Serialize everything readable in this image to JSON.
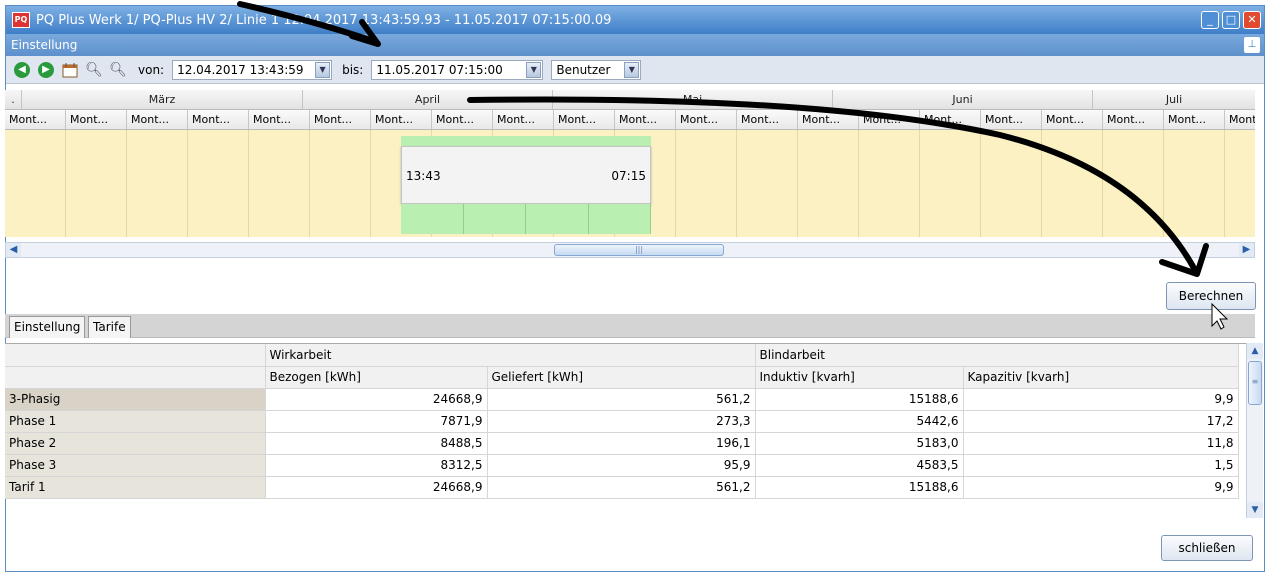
{
  "window": {
    "title": "PQ Plus Werk 1/ PQ-Plus HV 2/ Linie 1 12.04.2017 13:43:59.93 - 11.05.2017 07:15:00.09",
    "icon": "app-logo-icon"
  },
  "panel": {
    "title": "Einstellung",
    "pin_icon": "pin-icon"
  },
  "toolbar": {
    "von_label": "von:",
    "von_value": "12.04.2017 13:43:59",
    "bis_label": "bis:",
    "bis_value": "11.05.2017 07:15:00",
    "mode_value": "Benutzer"
  },
  "timeline": {
    "corner": ".",
    "months": [
      "März",
      "April",
      "Mai",
      "Juni",
      "Juli"
    ],
    "week_label": "Mont...",
    "selection_start": "13:43",
    "selection_end": "07:15"
  },
  "actions": {
    "berechnen": "Berechnen",
    "schliessen": "schließen"
  },
  "tabs": [
    "Einstellung",
    "Tarife"
  ],
  "table": {
    "group_headers": [
      "Wirkarbeit",
      "Blindarbeit"
    ],
    "columns": [
      "Bezogen [kWh]",
      "Geliefert [kWh]",
      "Induktiv [kvarh]",
      "Kapazitiv [kvarh]"
    ],
    "rows": [
      {
        "label": "3-Phasig",
        "values": [
          "24668,9",
          "561,2",
          "15188,6",
          "9,9"
        ]
      },
      {
        "label": "Phase 1",
        "values": [
          "7871,9",
          "273,3",
          "5442,6",
          "17,2"
        ]
      },
      {
        "label": "Phase 2",
        "values": [
          "8488,5",
          "196,1",
          "5183,0",
          "11,8"
        ]
      },
      {
        "label": "Phase 3",
        "values": [
          "8312,5",
          "95,9",
          "4583,5",
          "1,5"
        ]
      },
      {
        "label": "Tarif 1",
        "values": [
          "24668,9",
          "561,2",
          "15188,6",
          "9,9"
        ]
      }
    ]
  },
  "colors": {
    "titlebar": "#3e7ec8",
    "timeline_bg": "#fcf1c2",
    "selection": "#b9f0b1"
  }
}
